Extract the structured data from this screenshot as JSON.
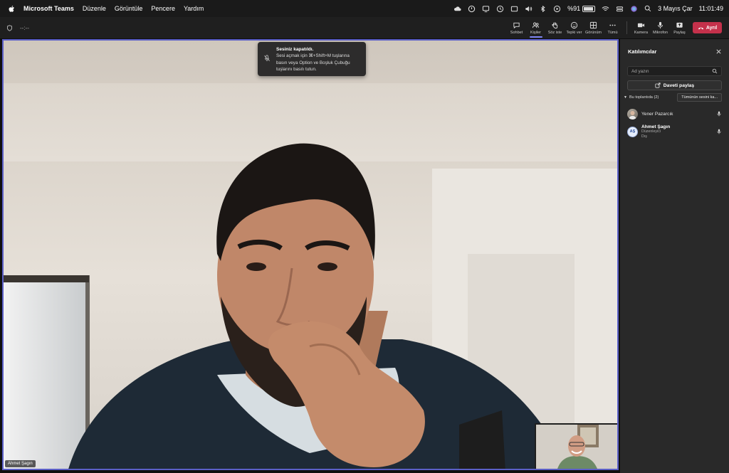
{
  "menubar": {
    "app_name": "Microsoft Teams",
    "menus": [
      "Düzenle",
      "Görüntüle",
      "Pencere",
      "Yardım"
    ],
    "battery": "%91",
    "date": "3 Mayıs Çar",
    "time": "11:01:49"
  },
  "toolbar": {
    "timer": "--:--",
    "buttons": [
      {
        "label": "Sohbet",
        "icon": "chat-icon"
      },
      {
        "label": "Kişiler",
        "icon": "people-icon",
        "active": true
      },
      {
        "label": "Söz iste",
        "icon": "raise-hand-icon"
      },
      {
        "label": "Tepki ver",
        "icon": "react-icon"
      },
      {
        "label": "Görünüm",
        "icon": "view-grid-icon"
      },
      {
        "label": "Tümü",
        "icon": "more-icon"
      },
      {
        "label": "Kamera",
        "icon": "camera-icon"
      },
      {
        "label": "Mikrofon",
        "icon": "microphone-icon"
      },
      {
        "label": "Paylaş",
        "icon": "share-icon"
      }
    ],
    "leave_label": "Ayrıl",
    "leave_color": "#c4314b"
  },
  "toast": {
    "title": "Sesiniz kapatıldı.",
    "body": "Sesi açmak için ⌘+Shift+M tuşlarına basın veya Option ve Boşluk Çubuğu tuşlarını basılı tutun."
  },
  "video": {
    "name_tag": "Ahmet Şagın"
  },
  "panel": {
    "title": "Katılımcılar",
    "search_placeholder": "Ad yazın",
    "invite_label": "Daveti paylaş",
    "section_label": "Bu toplantıda (2)",
    "mute_all_label": "Tümünün sesini ka...",
    "participants": [
      {
        "name": "Yener Pazarcık"
      },
      {
        "initials": "AŞ",
        "name": "Ahmet Şagın",
        "role": "Düzenleyici",
        "org": "Dış"
      }
    ]
  },
  "colors": {
    "accent": "#5b5fc7",
    "background": "#1f1f1f",
    "panel": "#292929"
  }
}
